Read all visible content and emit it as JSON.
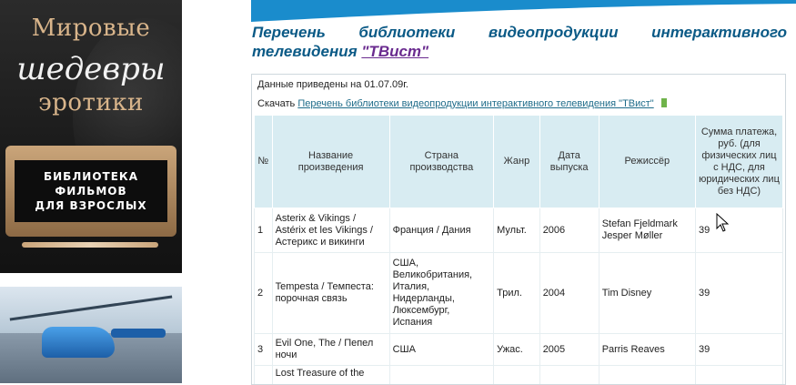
{
  "ads": {
    "ad1": {
      "line1": "Мировые",
      "line2": "шедевры",
      "line3": "эротики",
      "panel_lines": [
        "БИБЛИОТЕКА",
        "ФИЛЬМОВ",
        "ДЛЯ ВЗРОСЛЫХ"
      ]
    }
  },
  "page": {
    "title_prefix": "Перечень библиотеки видеопродукции интерактивного телевидения ",
    "title_brand": "\"ТВист\""
  },
  "meta": {
    "date_text": "Данные приведены на 01.07.09г.",
    "download_label": "Скачать ",
    "download_link": "Перечень библиотеки видеопродукции интерактивного телевидения \"ТВист\""
  },
  "table": {
    "headers": [
      "№",
      "Название произведения",
      "Страна производства",
      "Жанр",
      "Дата выпуска",
      "Режиссёр",
      "Сумма платежа, руб. (для физических лиц с НДС, для юридических лиц без НДС)"
    ],
    "rows": [
      {
        "num": "1",
        "title": "Asterix & Vikings / Astérix et les Vikings / Астерикс и викинги",
        "country": "Франция / Дания",
        "genre": "Мульт.",
        "year": "2006",
        "director": "Stefan Fjeldmark Jesper Møller",
        "price": "39"
      },
      {
        "num": "2",
        "title": "Tempesta / Темпеста: порочная связь",
        "country": "США, Великобритания, Италия, Нидерланды, Люксембург, Испания",
        "genre": "Трил.",
        "year": "2004",
        "director": "Tim Disney",
        "price": "39"
      },
      {
        "num": "3",
        "title": "Evil One, The / Пепел ночи",
        "country": "США",
        "genre": "Ужас.",
        "year": "2005",
        "director": "Parris Reaves",
        "price": "39"
      },
      {
        "num": "",
        "title": "Lost Treasure of the",
        "country": "",
        "genre": "",
        "year": "",
        "director": "",
        "price": ""
      }
    ]
  },
  "colors": {
    "title": "#0b5a86",
    "brand_link": "#6a2b8f",
    "header_bg": "#d8ecf2",
    "link": "#1f6c8a",
    "banner": "#1a8ccc"
  },
  "icons": {
    "download_file": "xls-file-icon",
    "mouse": "mouse-pointer-icon"
  }
}
